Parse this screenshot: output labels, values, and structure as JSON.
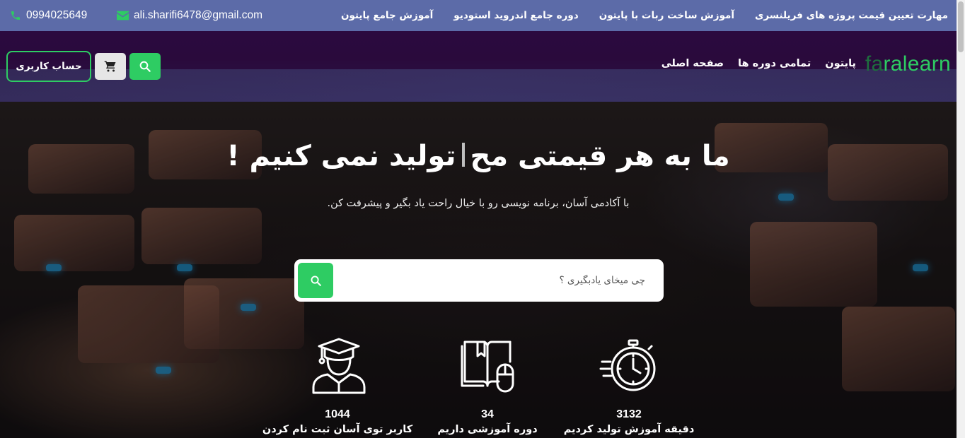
{
  "topbar": {
    "phone": "0994025649",
    "email": "ali.sharifi6478@gmail.com",
    "links": [
      "آموزش جامع پایتون",
      "دوره جامع اندروید استودیو",
      "آموزش ساخت ربات با پایتون",
      "مهارت تعیین قیمت پروژه های فریلنسری"
    ]
  },
  "header": {
    "logo_part1": "fa",
    "logo_part2": "ralearn",
    "nav": [
      "صفحه اصلی",
      "تمامی دوره ها",
      "پایتون"
    ],
    "account_label": "حساب کاربری"
  },
  "hero": {
    "title_before": "ما به هر قیمتی مح",
    "title_after": "تولید نمی کنیم !",
    "subtitle": "با آکادمی آسان، برنامه نویسی رو با خیال راحت یاد بگیر و پیشرفت کن.",
    "search_placeholder": "چی میخای یادبگیری ؟"
  },
  "stats": [
    {
      "icon": "stopwatch-icon",
      "number": "3132",
      "label": "دقیقه آموزش تولید کردیم"
    },
    {
      "icon": "book-mouse-icon",
      "number": "34",
      "label": "دوره آموزشی داریم"
    },
    {
      "icon": "graduate-icon",
      "number": "1044",
      "label": "کاربر توی آسان ثبت نام کردن"
    }
  ],
  "colors": {
    "accent": "#2ecc63",
    "topbar": "#5c6ba8",
    "header": "#2b0a3f"
  }
}
